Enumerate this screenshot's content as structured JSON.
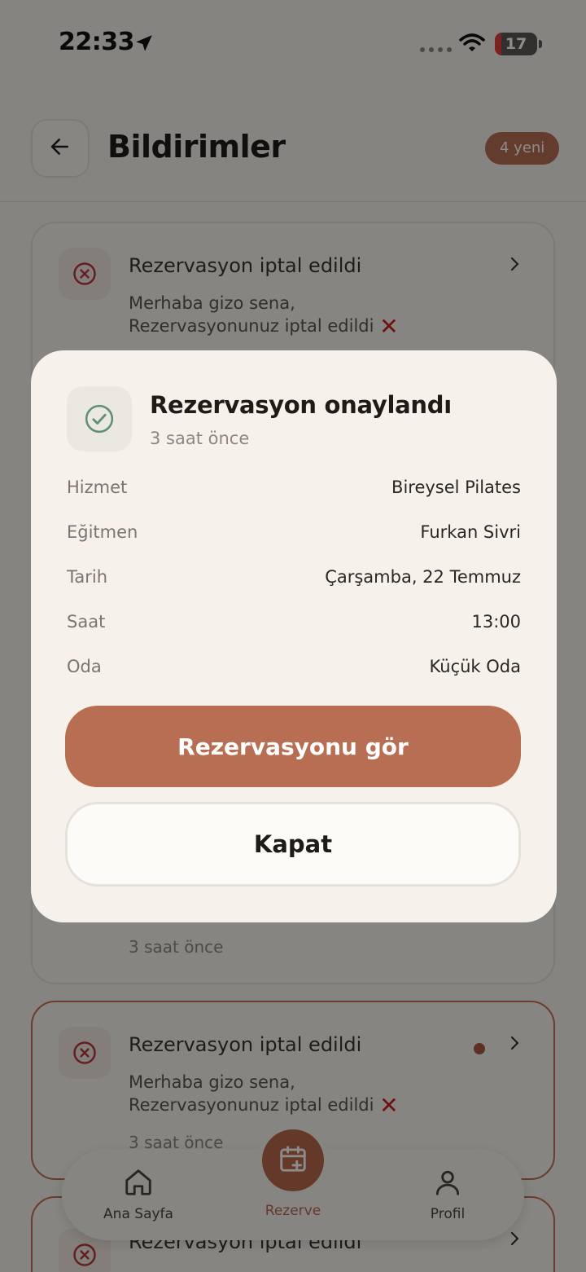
{
  "status_bar": {
    "time": "22:33",
    "battery_level": "17"
  },
  "header": {
    "title": "Bildirimler",
    "new_badge": "4 yeni"
  },
  "notifications": [
    {
      "title": "Rezervasyon iptal edildi",
      "greeting": "Merhaba gizo sena,",
      "message": "Rezervasyonunuz iptal edildi",
      "time": "",
      "unread": false
    },
    {
      "title": "",
      "greeting": "",
      "message": "",
      "time": "3 saat önce",
      "unread": false
    },
    {
      "title": "Rezervasyon iptal edildi",
      "greeting": "Merhaba gizo sena,",
      "message": "Rezervasyonunuz iptal edildi",
      "time": "3 saat önce",
      "unread": true
    },
    {
      "title": "Rezervasyon iptal edildi",
      "greeting": "",
      "message": "",
      "time": "",
      "unread": true
    }
  ],
  "tabbar": {
    "home_label": "Ana Sayfa",
    "reserve_label": "Rezerve",
    "profile_label": "Profil",
    "active": "Rezerve"
  },
  "modal": {
    "title": "Rezervasyon onaylandı",
    "time": "3 saat önce",
    "rows": [
      {
        "key": "Hizmet",
        "value": "Bireysel Pilates"
      },
      {
        "key": "Eğitmen",
        "value": "Furkan Sivri"
      },
      {
        "key": "Tarih",
        "value": "Çarşamba, 22 Temmuz"
      },
      {
        "key": "Saat",
        "value": "13:00"
      },
      {
        "key": "Oda",
        "value": "Küçük Oda"
      }
    ],
    "primary_button": "Rezervasyonu gör",
    "secondary_button": "Kapat"
  },
  "colors": {
    "accent": "#b76e53",
    "background": "#f3f0e9",
    "error": "#c81e1e",
    "success": "#5f8f77"
  }
}
